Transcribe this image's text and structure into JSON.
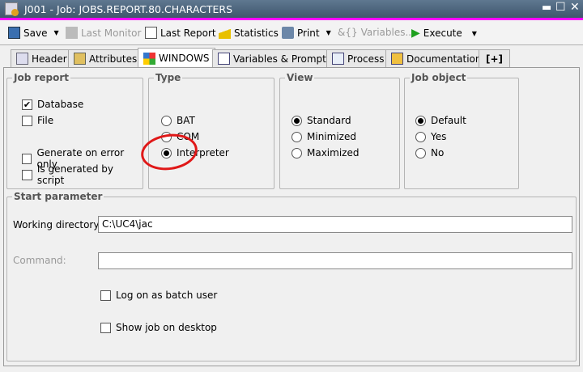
{
  "window": {
    "title": "J001 - Job: JOBS.REPORT.80.CHARACTERS",
    "accent": "#ff00ff"
  },
  "toolbar": {
    "save": "Save",
    "last_monitor": "Last Monitor",
    "last_report": "Last Report",
    "statistics": "Statistics",
    "print": "Print",
    "variables": "Variables...",
    "execute": "Execute"
  },
  "tabs": [
    "Header",
    "Attributes",
    "WINDOWS",
    "Variables & Prompts",
    "Process",
    "Documentation",
    "[+]"
  ],
  "job_report": {
    "label": "Job report",
    "database": "Database",
    "database_checked": true,
    "file": "File",
    "file_checked": false,
    "gen_on_error": "Generate on error only",
    "gen_on_error_checked": false,
    "gen_by_script": "Is generated by script",
    "gen_by_script_checked": false
  },
  "type": {
    "label": "Type",
    "options": [
      "BAT",
      "COM",
      "Interpreter"
    ],
    "selected": "Interpreter"
  },
  "view": {
    "label": "View",
    "options": [
      "Standard",
      "Minimized",
      "Maximized"
    ],
    "selected": "Standard"
  },
  "job_object": {
    "label": "Job object",
    "options": [
      "Default",
      "Yes",
      "No"
    ],
    "selected": "Default"
  },
  "start_parameter": {
    "label": "Start parameter",
    "working_dir_label": "Working directory:",
    "working_dir_value": "C:\\UC4\\jac",
    "command_label": "Command:",
    "command_value": "",
    "log_on_batch": "Log on as batch user",
    "log_on_batch_checked": false,
    "show_desktop": "Show job on desktop",
    "show_desktop_checked": false
  }
}
